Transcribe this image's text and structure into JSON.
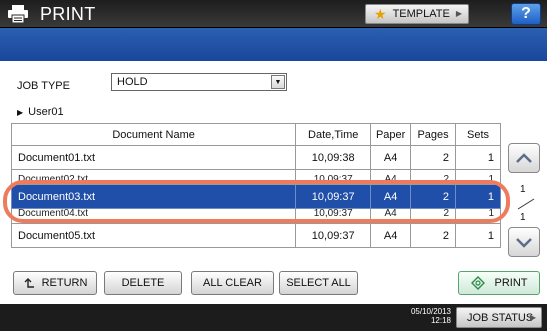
{
  "header": {
    "title": "PRINT",
    "template_label": "TEMPLATE",
    "help_label": "?"
  },
  "job_type": {
    "label": "JOB TYPE",
    "selected": "HOLD"
  },
  "user": {
    "name": "User01"
  },
  "table": {
    "columns": [
      "Document Name",
      "Date,Time",
      "Paper",
      "Pages",
      "Sets"
    ],
    "rows": [
      {
        "name": "Document01.txt",
        "datetime": "10,09:38",
        "paper": "A4",
        "pages": "2",
        "sets": "1"
      },
      {
        "name": "Document02.txt",
        "datetime": "10,09:37",
        "paper": "A4",
        "pages": "2",
        "sets": "1"
      },
      {
        "name": "Document03.txt",
        "datetime": "10,09:37",
        "paper": "A4",
        "pages": "2",
        "sets": "1"
      },
      {
        "name": "Document04.txt",
        "datetime": "10,09:37",
        "paper": "A4",
        "pages": "2",
        "sets": "1"
      },
      {
        "name": "Document05.txt",
        "datetime": "10,09:37",
        "paper": "A4",
        "pages": "2",
        "sets": "1"
      }
    ],
    "selected_index": 2
  },
  "pagination": {
    "current": "1",
    "total": "1"
  },
  "buttons": {
    "return": "RETURN",
    "delete": "DELETE",
    "all_clear": "ALL CLEAR",
    "select_all": "SELECT ALL",
    "print": "PRINT"
  },
  "status": {
    "date": "05/10/2013",
    "time": "12:18",
    "job_status": "JOB STATUS"
  },
  "colors": {
    "header_blue": "#1f4fa8",
    "selected_row": "#1f4fa8",
    "highlight_ring": "#ee7b5d"
  }
}
